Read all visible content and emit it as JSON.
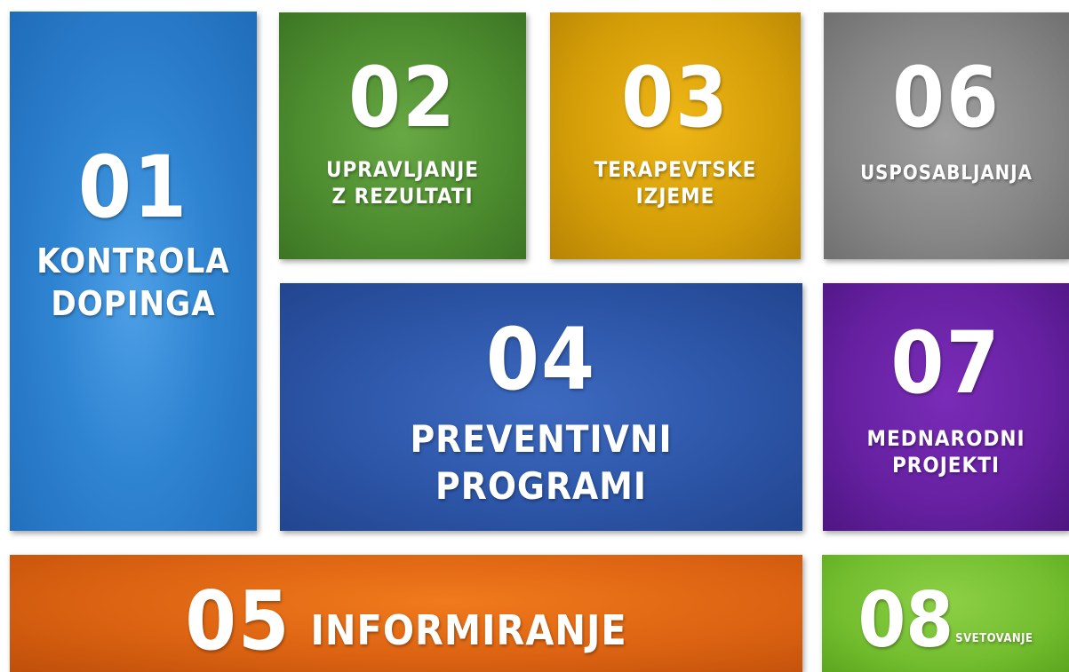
{
  "tiles": {
    "t01": {
      "number": "01",
      "label_line1": "KONTROLA",
      "label_line2": "DOPINGA",
      "color": "#2f84d2"
    },
    "t02": {
      "number": "02",
      "label_line1": "UPRAVLJANJE",
      "label_line2": "Z REZULTATI",
      "color": "#4c8b2e"
    },
    "t03": {
      "number": "03",
      "label_line1": "TERAPEVTSKE",
      "label_line2": "IZJEME",
      "color": "#d39d08"
    },
    "t04": {
      "number": "04",
      "label_line1": "PREVENTIVNI",
      "label_line2": "PROGRAMI",
      "color": "#2d56a8"
    },
    "t05": {
      "number": "05",
      "label": "INFORMIRANJE",
      "color": "#dc6312"
    },
    "t06": {
      "number": "06",
      "label": "USPOSABLJANJA",
      "color": "#868686"
    },
    "t07": {
      "number": "07",
      "label_line1": "MEDNARODNI",
      "label_line2": "PROJEKTI",
      "color": "#6520a0"
    },
    "t08": {
      "number": "08",
      "label": "SVETOVANJE",
      "color": "#74be30"
    }
  }
}
